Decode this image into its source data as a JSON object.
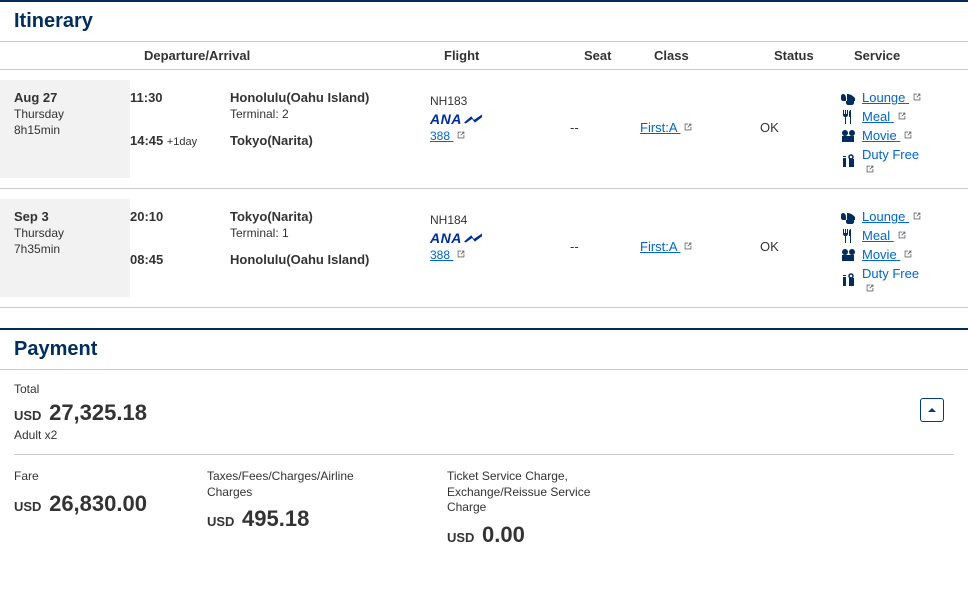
{
  "itinerary": {
    "title": "Itinerary",
    "headers": {
      "depArr": "Departure/Arrival",
      "flight": "Flight",
      "seat": "Seat",
      "class": "Class",
      "status": "Status",
      "service": "Service"
    },
    "segments": [
      {
        "date": "Aug 27",
        "dow": "Thursday",
        "duration": "8h15min",
        "depTime": "11:30",
        "depLoc": "Honolulu(Oahu Island)",
        "depTerminal": "Terminal: 2",
        "arrTime": "14:45",
        "arrPlus": "+1day",
        "arrLoc": "Tokyo(Narita)",
        "flightNum": "NH183",
        "aircraft": "388",
        "seat": "--",
        "class": "First:A",
        "status": "OK"
      },
      {
        "date": "Sep 3",
        "dow": "Thursday",
        "duration": "7h35min",
        "depTime": "20:10",
        "depLoc": "Tokyo(Narita)",
        "depTerminal": "Terminal: 1",
        "arrTime": "08:45",
        "arrPlus": "",
        "arrLoc": "Honolulu(Oahu Island)",
        "flightNum": "NH184",
        "aircraft": "388",
        "seat": "--",
        "class": "First:A",
        "status": "OK"
      }
    ],
    "services": {
      "lounge": "Lounge",
      "meal": "Meal",
      "movie": "Movie",
      "dutyFree": "Duty Free"
    }
  },
  "payment": {
    "title": "Payment",
    "totalLabel": "Total",
    "currency": "USD",
    "totalAmount": "27,325.18",
    "pax": "Adult x2",
    "fareLabel": "Fare",
    "fareAmount": "26,830.00",
    "taxesLabel": "Taxes/Fees/Charges/Airline Charges",
    "taxesAmount": "495.18",
    "serviceLabel": "Ticket Service Charge, Exchange/Reissue Service Charge",
    "serviceAmount": "0.00"
  }
}
